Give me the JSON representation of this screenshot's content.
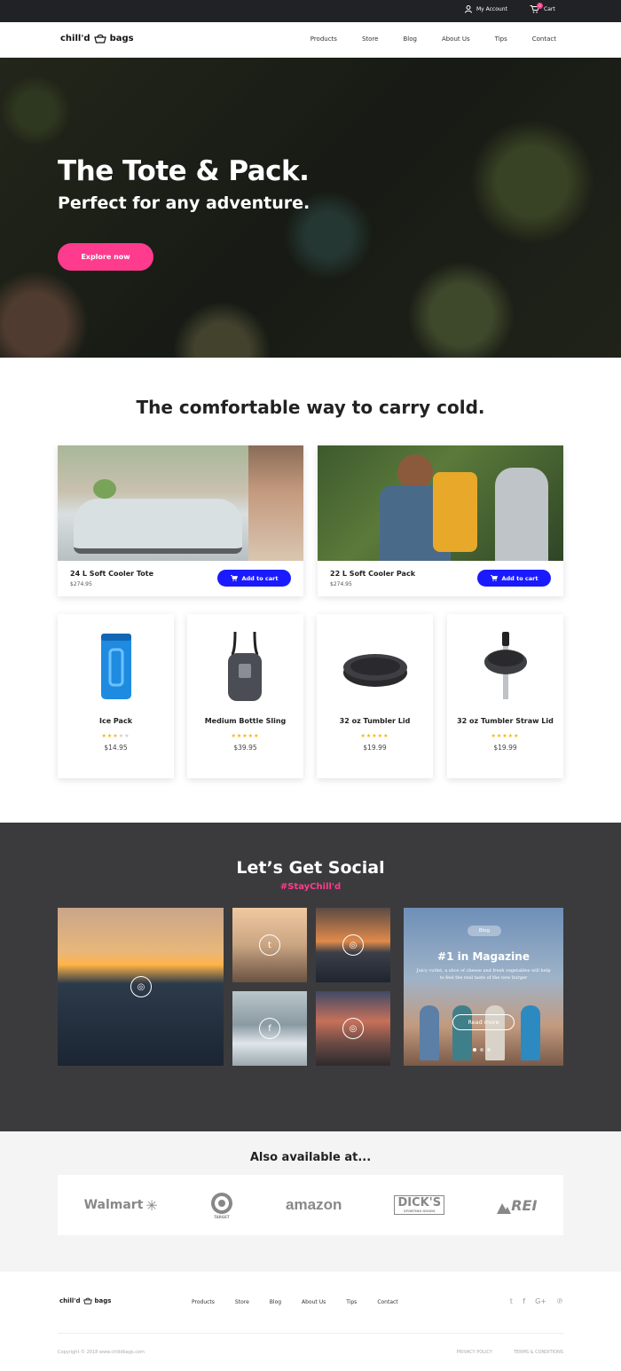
{
  "topbar": {
    "account_label": "My Account",
    "cart_label": "Cart",
    "cart_count": "0"
  },
  "nav": {
    "logo_left": "chill'd",
    "logo_right": "bags",
    "links": [
      "Products",
      "Store",
      "Blog",
      "About Us",
      "Tips",
      "Contact"
    ]
  },
  "hero": {
    "title": "The Tote & Pack.",
    "subtitle": "Perfect for any adventure.",
    "cta": "Explore now"
  },
  "products_section": {
    "title": "The comfortable way to carry cold."
  },
  "featured": [
    {
      "name": "24 L Soft Cooler Tote",
      "price": "$274.95",
      "button": "Add to cart"
    },
    {
      "name": "22 L Soft Cooler Pack",
      "price": "$274.95",
      "button": "Add to cart"
    }
  ],
  "products": [
    {
      "name": "Ice Pack",
      "price": "$14.95",
      "rating": 3
    },
    {
      "name": "Medium Bottle Sling",
      "price": "$39.95",
      "rating": 5
    },
    {
      "name": "32 oz Tumbler Lid",
      "price": "$19.99",
      "rating": 5
    },
    {
      "name": "32 oz Tumbler Straw Lid",
      "price": "$19.99",
      "rating": 5
    }
  ],
  "social": {
    "title": "Let’s Get Social",
    "hashtag": "#StayChill'd"
  },
  "blog": {
    "tag": "Blog",
    "title": "#1 in Magazine",
    "text": "Juicy cutlet, a slice of cheese and fresh vegetables will help to feel the real taste of the new burger",
    "button": "Read more"
  },
  "retailers": {
    "title": "Also available at...",
    "names": [
      "Walmart",
      "TARGET",
      "amazon",
      "DICK'S",
      "REI"
    ],
    "dicks_sub": "SPORTING GOODS"
  },
  "footer": {
    "logo_left": "chill'd",
    "logo_right": "bags",
    "links": [
      "Products",
      "Store",
      "Blog",
      "About Us",
      "Tips",
      "Contact"
    ],
    "copyright": "Copyright © 2018 www.chilldbags.com",
    "legal": [
      "PRIVACY POLICY",
      "TERMS & CONDITIONS"
    ]
  },
  "colors": {
    "accent": "#ff3b8d",
    "button_blue": "#1a1aff",
    "dark": "#212226",
    "social_bg": "#3b3b3d"
  },
  "icons": [
    "user-icon",
    "cart-icon",
    "bag-icon",
    "instagram-icon",
    "twitter-icon",
    "facebook-icon",
    "google-plus-icon",
    "pinterest-icon",
    "star-icon"
  ]
}
